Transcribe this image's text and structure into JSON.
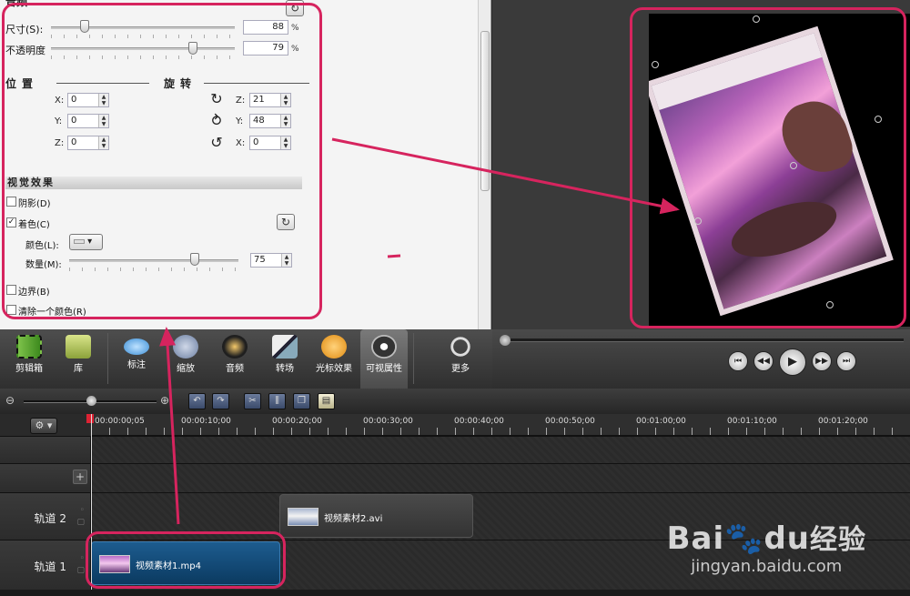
{
  "properties": {
    "section_top": "音频",
    "size_label": "尺寸(S):",
    "size_value": "88",
    "opacity_label": "不透明度",
    "opacity_value": "79",
    "percent": "%",
    "position_title": "位置",
    "rotation_title": "旋转",
    "position": [
      {
        "axis": "X:",
        "value": "0"
      },
      {
        "axis": "Y:",
        "value": "0"
      },
      {
        "axis": "Z:",
        "value": "0"
      }
    ],
    "rotation": [
      {
        "axis": "Z:",
        "value": "21"
      },
      {
        "axis": "Y:",
        "value": "48"
      },
      {
        "axis": "X:",
        "value": "0"
      }
    ],
    "visual_effects_title": "视觉效果",
    "shadow_label": "阴影(D)",
    "tint_label": "着色(C)",
    "tint_checked": true,
    "color_label": "颜色(L):",
    "amount_label": "数量(M):",
    "amount_value": "75",
    "border_label": "边界(B)",
    "remove_color_label": "清除一个颜色(R)"
  },
  "toolbar": {
    "items": [
      {
        "label": "剪辑箱",
        "icon": "film-strip-icon"
      },
      {
        "label": "库",
        "icon": "folder-icon"
      },
      {
        "label": "标注",
        "icon": "callout-bubble-icon"
      },
      {
        "label": "缩放",
        "icon": "magnifier-icon"
      },
      {
        "label": "音频",
        "icon": "speaker-icon"
      },
      {
        "label": "转场",
        "icon": "transition-icon"
      },
      {
        "label": "光标效果",
        "icon": "cursor-effect-icon"
      },
      {
        "label": "可视属性",
        "icon": "visual-properties-icon",
        "active": true
      },
      {
        "label": "更多",
        "icon": "more-icon"
      }
    ]
  },
  "timeline": {
    "ruler_labels": [
      "00:00:00;05",
      "00:00:10;00",
      "00:00:20;00",
      "00:00:30;00",
      "00:00:40;00",
      "00:00:50;00",
      "00:01:00;00",
      "00:01:10;00",
      "00:01:20;00"
    ],
    "tracks": [
      {
        "name": "轨道 2",
        "clip": "视频素材2.avi"
      },
      {
        "name": "轨道 1",
        "clip": "视频素材1.mp4"
      }
    ]
  },
  "watermark": {
    "brand": "Bai",
    "brand_mid": "du",
    "brand_cn": "经验",
    "url": "jingyan.baidu.com"
  },
  "colors": {
    "annotation": "#d6245e",
    "active_clip": "#0f4a78",
    "inactive_clip": "#3d3d3d"
  }
}
